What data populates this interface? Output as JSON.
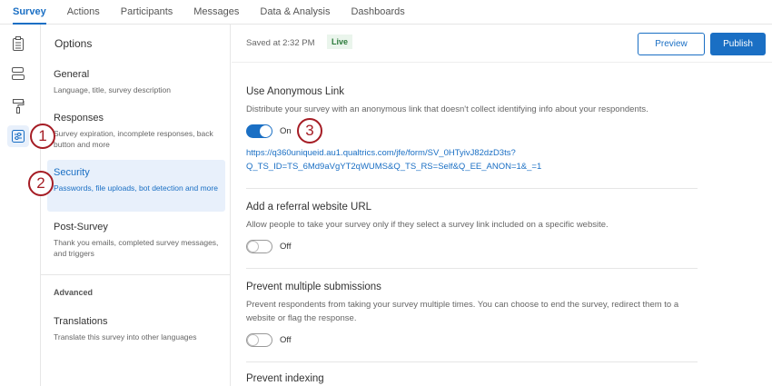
{
  "tabs": [
    "Survey",
    "Actions",
    "Participants",
    "Messages",
    "Data & Analysis",
    "Dashboards"
  ],
  "options": {
    "title": "Options",
    "items": [
      {
        "title": "General",
        "desc": "Language, title, survey description"
      },
      {
        "title": "Responses",
        "desc": "Survey expiration, incomplete responses, back button and more"
      },
      {
        "title": "Security",
        "desc": "Passwords, file uploads, bot detection and more"
      },
      {
        "title": "Post-Survey",
        "desc": "Thank you emails, completed survey messages, and triggers"
      }
    ],
    "advanced": "Advanced",
    "translations": {
      "title": "Translations",
      "desc": "Translate this survey into other languages"
    }
  },
  "header": {
    "saved": "Saved at 2:32 PM",
    "status": "Live",
    "preview": "Preview",
    "publish": "Publish"
  },
  "sections": [
    {
      "title": "Use Anonymous Link",
      "desc": "Distribute your survey with an anonymous link that doesn't collect identifying info about your respondents.",
      "toggle": "On",
      "link1": "https://q360uniqueid.au1.qualtrics.com/jfe/form/SV_0HTyivJ82dzD3ts?",
      "link2": "Q_TS_ID=TS_6Md9aVgYT2qWUMS&Q_TS_RS=Self&Q_EE_ANON=1&_=1"
    },
    {
      "title": "Add a referral website URL",
      "desc": "Allow people to take your survey only if they select a survey link included on a specific website.",
      "toggle": "Off"
    },
    {
      "title": "Prevent multiple submissions",
      "desc": "Prevent respondents from taking your survey multiple times. You can choose to end the survey, redirect them to a website or flag the response.",
      "toggle": "Off"
    },
    {
      "title": "Prevent indexing"
    }
  ],
  "callouts": [
    "1",
    "2",
    "3"
  ]
}
